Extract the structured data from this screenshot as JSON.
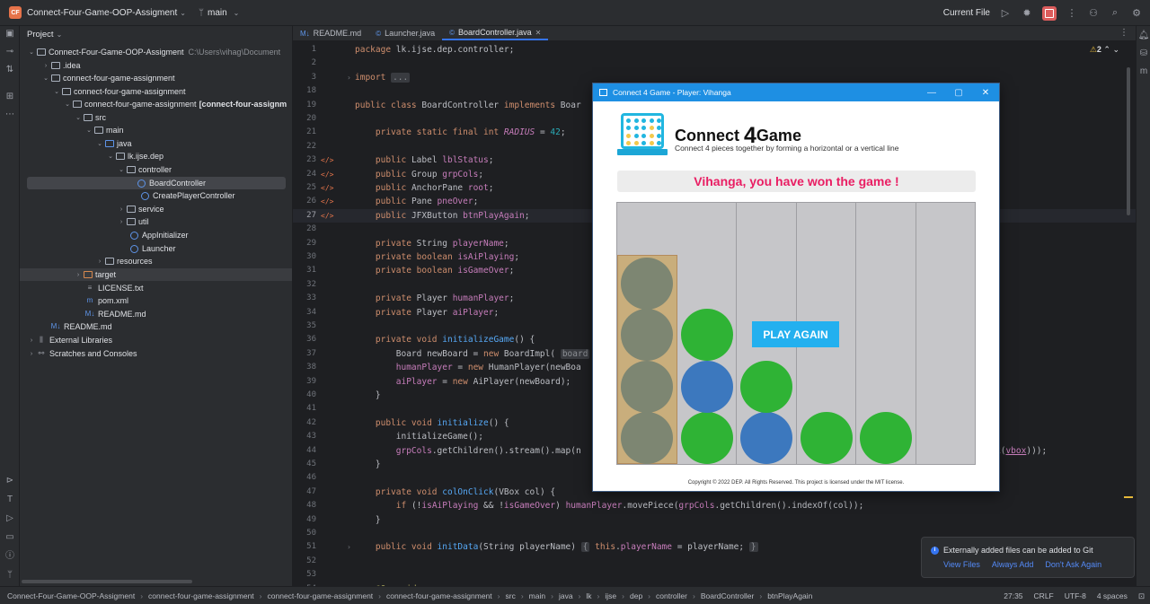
{
  "titlebar": {
    "project_badge": "CF",
    "project_name": "Connect-Four-Game-OOP-Assigment",
    "branch": "main",
    "run_config": "Current File"
  },
  "project_panel": {
    "title": "Project",
    "tree": [
      {
        "label": "Connect-Four-Game-OOP-Assigment",
        "extra": "C:\\Users\\vihag\\Document"
      },
      {
        "label": ".idea"
      },
      {
        "label": "connect-four-game-assignment"
      },
      {
        "label": "connect-four-game-assignment"
      },
      {
        "label": "connect-four-game-assignment",
        "extra": "[connect-four-assignm"
      },
      {
        "label": "src"
      },
      {
        "label": "main"
      },
      {
        "label": "java"
      },
      {
        "label": "lk.ijse.dep"
      },
      {
        "label": "controller"
      },
      {
        "label": "BoardController"
      },
      {
        "label": "CreatePlayerController"
      },
      {
        "label": "service"
      },
      {
        "label": "util"
      },
      {
        "label": "AppInitializer"
      },
      {
        "label": "Launcher"
      },
      {
        "label": "resources"
      },
      {
        "label": "target"
      },
      {
        "label": "LICENSE.txt"
      },
      {
        "label": "pom.xml"
      },
      {
        "label": "README.md"
      },
      {
        "label": "README.md"
      },
      {
        "label": "External Libraries"
      },
      {
        "label": "Scratches and Consoles"
      }
    ]
  },
  "tabs": [
    {
      "icon": "M↓",
      "label": "README.md"
    },
    {
      "icon": "©",
      "label": "Launcher.java"
    },
    {
      "icon": "©",
      "label": "BoardController.java"
    }
  ],
  "editor": {
    "warnings": "2",
    "line_numbers": [
      "1",
      "2",
      "3",
      "18",
      "19",
      "20",
      "21",
      "22",
      "23",
      "24",
      "25",
      "26",
      "27",
      "28",
      "29",
      "30",
      "31",
      "32",
      "33",
      "34",
      "35",
      "36",
      "37",
      "38",
      "39",
      "40",
      "41",
      "42",
      "43",
      "44",
      "45",
      "46",
      "47",
      "48",
      "49",
      "50",
      "51",
      "52",
      "53",
      "54",
      "55"
    ]
  },
  "game": {
    "window_title": "Connect 4 Game - Player: Vihanga",
    "title_prefix": "Connect",
    "title_num": "4",
    "title_suffix": "Game",
    "subtitle": "Connect 4 pieces together by forming a horizontal or a vertical line",
    "status": "Vihanga, you have won the game !",
    "play_again": "PLAY AGAIN",
    "copyright": "Copyright © 2022 DEP. All Rights Reserved. This project is licensed under the MIT license.",
    "board": [
      [
        "gray",
        "gray",
        "gray",
        "gray"
      ],
      [
        "green",
        "blue",
        "green"
      ],
      [
        "blue",
        "green"
      ],
      [
        "green"
      ],
      [
        "green"
      ],
      []
    ],
    "colors": {
      "gray": "#7d8672",
      "green": "#2fb335",
      "blue": "#3c78be",
      "status": "#e91e63",
      "winner_col": "#c9ae7c"
    }
  },
  "notification": {
    "message": "Externally added files can be added to Git",
    "actions": [
      "View Files",
      "Always Add",
      "Don't Ask Again"
    ]
  },
  "statusbar": {
    "breadcrumb": [
      "Connect-Four-Game-OOP-Assigment",
      "connect-four-game-assignment",
      "connect-four-game-assignment",
      "connect-four-game-assignment",
      "src",
      "main",
      "java",
      "lk",
      "ijse",
      "dep",
      "controller",
      "BoardController",
      "btnPlayAgain"
    ],
    "position": "27:35",
    "line_sep": "CRLF",
    "encoding": "UTF-8",
    "indent": "4 spaces"
  }
}
